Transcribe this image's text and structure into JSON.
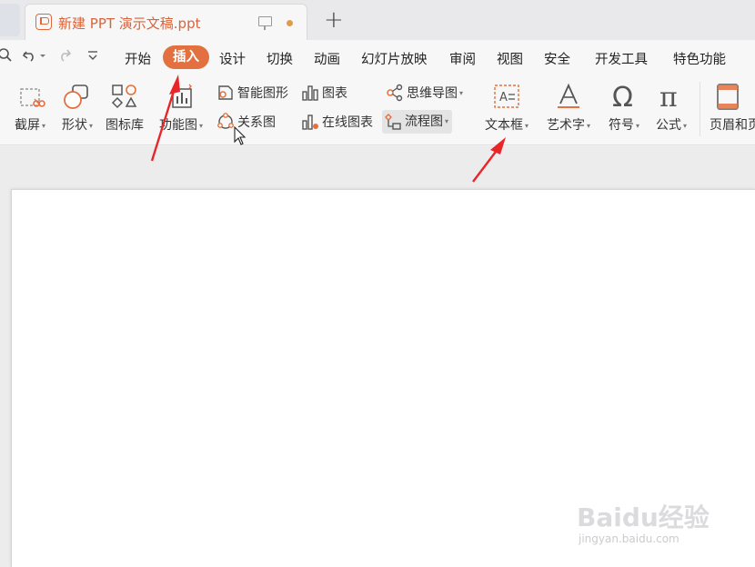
{
  "tab": {
    "title": "新建 PPT 演示文稿.ppt",
    "new_tab_symbol": "+",
    "has_unsaved_changes": true
  },
  "quick_access": {
    "search_icon": "zoom-icon",
    "undo_icon": "undo-icon",
    "redo_icon": "redo-icon",
    "more_icon": "customize-icon"
  },
  "menu": {
    "items": [
      "开始",
      "插入",
      "设计",
      "切换",
      "动画",
      "幻灯片放映",
      "审阅",
      "视图",
      "安全",
      "开发工具",
      "特色功能"
    ],
    "active": "插入"
  },
  "ribbon": {
    "screenshot": "截屏",
    "shape": "形状",
    "icon_library": "图标库",
    "function_chart": "功能图",
    "smart_graphic": "智能图形",
    "chart": "图表",
    "mind_map": "思维导图",
    "relation_chart": "关系图",
    "online_chart": "在线图表",
    "flowchart": "流程图",
    "text_box": "文本框",
    "word_art": "艺术字",
    "symbol": "符号",
    "formula": "公式",
    "header_footer": "页眉和页"
  },
  "watermark": {
    "main": "Baidu经验",
    "sub": "jingyan.baidu.com"
  },
  "colors": {
    "accent": "#e3703f",
    "annotation_arrow": "#e8262a",
    "tab_title": "#d9633a"
  }
}
